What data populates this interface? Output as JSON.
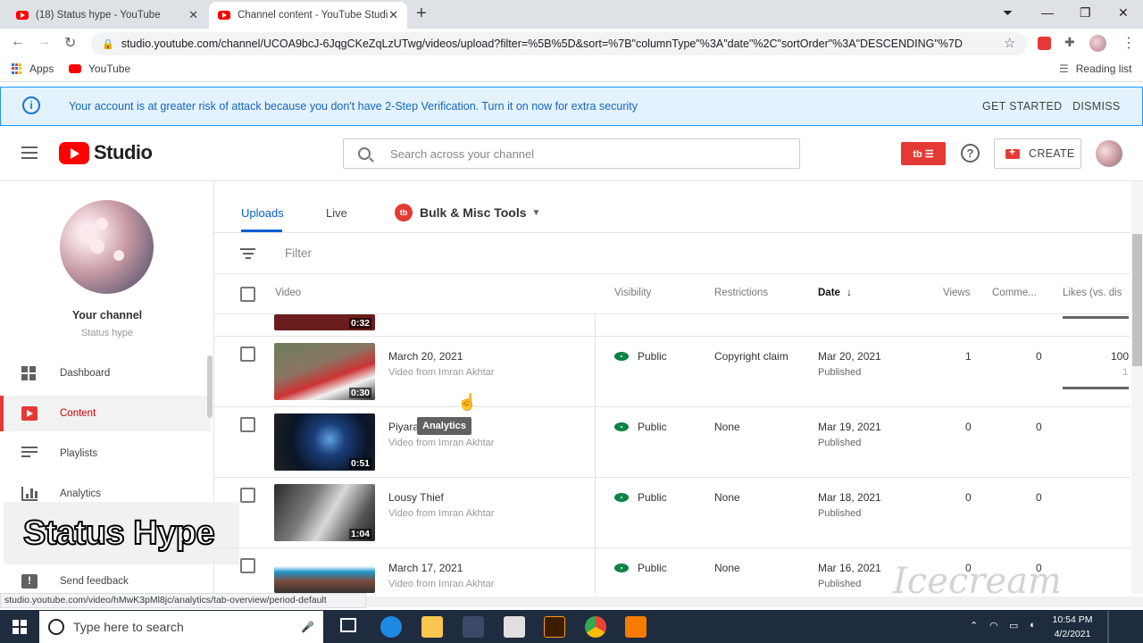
{
  "browser": {
    "tabs": [
      {
        "title": "(18) Status hype - YouTube"
      },
      {
        "title": "Channel content - YouTube Studio"
      }
    ],
    "url": "studio.youtube.com/channel/UCOA9bcJ-6JqgCKeZqLzUTwg/videos/upload?filter=%5B%5D&sort=%7B\"columnType\"%3A\"date\"%2C\"sortOrder\"%3A\"DESCENDING\"%7D",
    "bookmarks": {
      "apps": "Apps",
      "youtube": "YouTube",
      "reading_list": "Reading list"
    },
    "status_url": "studio.youtube.com/video/hMwK3pMl8jc/analytics/tab-overview/period-default"
  },
  "banner": {
    "message": "Your account is at greater risk of attack because you don't have 2-Step Verification. Turn it on now for extra security",
    "get_started": "GET STARTED",
    "dismiss": "DISMISS"
  },
  "header": {
    "logo_text": "Studio",
    "search_placeholder": "Search across your channel",
    "create_label": "CREATE"
  },
  "sidebar": {
    "channel_title": "Your channel",
    "channel_name": "Status hype",
    "items": [
      {
        "label": "Dashboard"
      },
      {
        "label": "Content"
      },
      {
        "label": "Playlists"
      },
      {
        "label": "Analytics"
      },
      {
        "label": "Send feedback"
      }
    ],
    "overlay_text": "Status Hype"
  },
  "content": {
    "tabs": {
      "uploads": "Uploads",
      "live": "Live",
      "bulk": "Bulk & Misc Tools"
    },
    "filter_label": "Filter",
    "columns": {
      "video": "Video",
      "visibility": "Visibility",
      "restrictions": "Restrictions",
      "date": "Date",
      "views": "Views",
      "comments": "Comme...",
      "likes": "Likes (vs. dis"
    },
    "partial_row": {
      "duration": "0:32"
    },
    "rows": [
      {
        "title": "March 20, 2021",
        "desc": "Video from Imran Akhtar",
        "duration": "0:30",
        "visibility": "Public",
        "restriction": "Copyright claim",
        "date": "Mar 20, 2021",
        "status": "Published",
        "views": "1",
        "comments": "0",
        "likes": "100",
        "likes_sub": "1"
      },
      {
        "title": "Piyara",
        "desc": "Video from Imran Akhtar",
        "duration": "0:51",
        "visibility": "Public",
        "restriction": "None",
        "date": "Mar 19, 2021",
        "status": "Published",
        "views": "0",
        "comments": "0"
      },
      {
        "title": "Lousy Thief",
        "desc": "Video from Imran Akhtar",
        "duration": "1:04",
        "visibility": "Public",
        "restriction": "None",
        "date": "Mar 18, 2021",
        "status": "Published",
        "views": "0",
        "comments": "0"
      },
      {
        "title": "March 17, 2021",
        "desc": "Video from Imran Akhtar",
        "visibility": "Public",
        "restriction": "None",
        "date": "Mar 16, 2021",
        "status": "Published",
        "views": "0",
        "comments": "0"
      }
    ],
    "tooltip": "Analytics"
  },
  "taskbar": {
    "search_placeholder": "Type here to search",
    "time": "10:54 PM",
    "date": "4/2/2021"
  },
  "watermark": "Icecream"
}
